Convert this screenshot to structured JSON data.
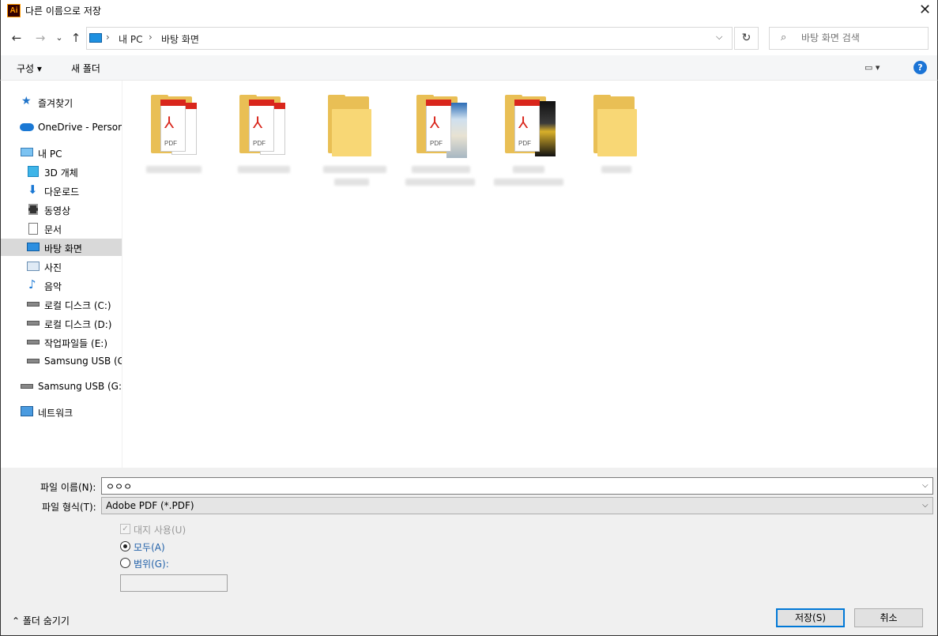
{
  "window": {
    "app_icon": "Ai",
    "title": "다른 이름으로 저장",
    "close": "✕"
  },
  "nav": {
    "back": "←",
    "forward": "→",
    "recent": "⌄",
    "up": "↑",
    "crumbs": [
      "내 PC",
      "바탕 화면"
    ],
    "refresh": "↻",
    "search_placeholder": "바탕 화면 검색"
  },
  "toolbar": {
    "organize": "구성 ▾",
    "new_folder": "새 폴더",
    "view": "▭ ▾",
    "help": "?"
  },
  "sidebar": {
    "items": [
      {
        "label": "즐겨찾기",
        "icon": "star-icon"
      },
      {
        "label": "OneDrive - Persona",
        "icon": "cloud-icon"
      },
      {
        "label": "내 PC",
        "icon": "computer-icon"
      },
      {
        "label": "3D 개체",
        "icon": "cube-icon"
      },
      {
        "label": "다운로드",
        "icon": "download-icon"
      },
      {
        "label": "동영상",
        "icon": "video-icon"
      },
      {
        "label": "문서",
        "icon": "document-icon"
      },
      {
        "label": "바탕 화면",
        "icon": "desktop-icon"
      },
      {
        "label": "사진",
        "icon": "picture-icon"
      },
      {
        "label": "음악",
        "icon": "music-icon"
      },
      {
        "label": "로컬 디스크 (C:)",
        "icon": "drive-icon"
      },
      {
        "label": "로컬 디스크 (D:)",
        "icon": "drive-icon"
      },
      {
        "label": "작업파일들 (E:)",
        "icon": "drive-icon"
      },
      {
        "label": "Samsung USB (G:)",
        "icon": "usb-icon"
      },
      {
        "label": "Samsung USB (G:)",
        "icon": "usb-icon"
      },
      {
        "label": "네트워크",
        "icon": "network-icon"
      }
    ]
  },
  "files": [
    {
      "type": "pdf-folder"
    },
    {
      "type": "pdf-folder"
    },
    {
      "type": "folder"
    },
    {
      "type": "pdf-magazine-folder"
    },
    {
      "type": "pdf-magazine-folder"
    },
    {
      "type": "folder"
    }
  ],
  "form": {
    "filename_label": "파일 이름(N):",
    "filename_value": "ㅇㅇㅇ",
    "filetype_label": "파일 형식(T):",
    "filetype_value": "Adobe PDF (*.PDF)",
    "artboard_label": "대지 사용(U)",
    "all_label": "모두(A)",
    "range_label": "범위(G):",
    "hide_folders": "⌃  폴더 숨기기",
    "save": "저장(S)",
    "cancel": "취소",
    "dropdown_arrow": "⌵"
  }
}
